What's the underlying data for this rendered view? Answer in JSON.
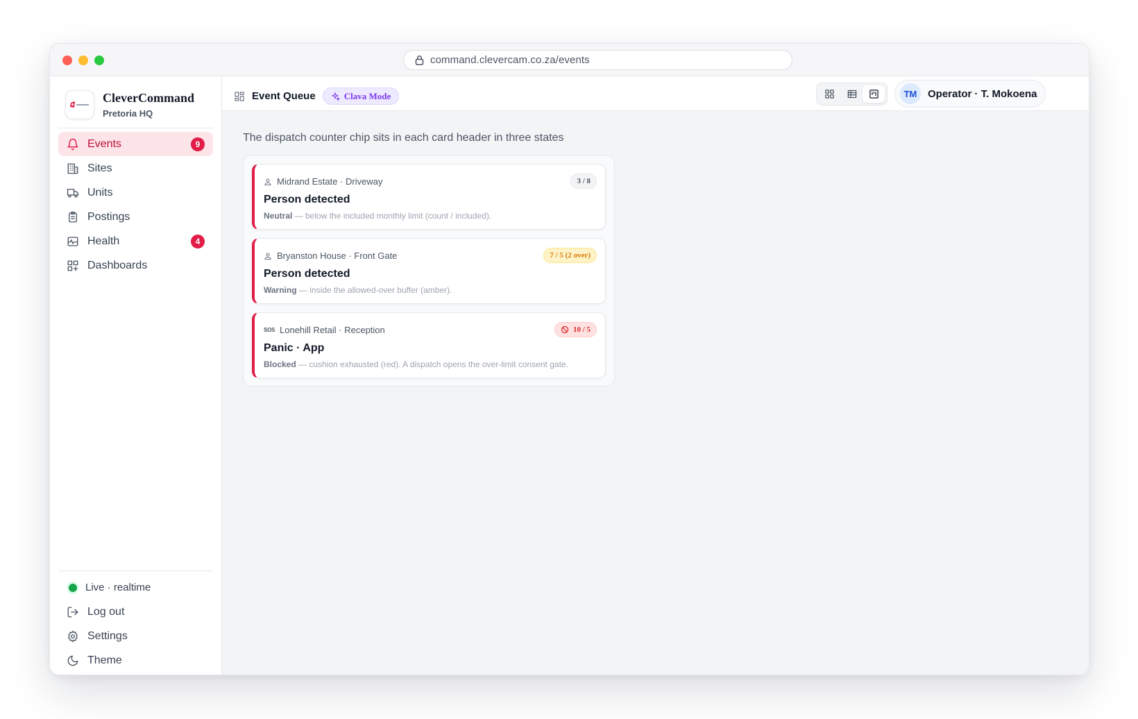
{
  "browser": {
    "url": "command.clevercam.co.za/events"
  },
  "brand": {
    "name": "CleverCommand",
    "subtitle": "Pretoria HQ"
  },
  "sidebar": {
    "items": [
      {
        "label": "Events",
        "icon": "bell-icon",
        "badge": "9",
        "active": true
      },
      {
        "label": "Sites",
        "icon": "building-icon"
      },
      {
        "label": "Units",
        "icon": "truck-icon"
      },
      {
        "label": "Postings",
        "icon": "clipboard-icon"
      },
      {
        "label": "Health",
        "icon": "activity-icon",
        "badge": "4"
      },
      {
        "label": "Dashboards",
        "icon": "grid-plus-icon"
      }
    ],
    "bottom": {
      "live": "Live · realtime",
      "logout": "Log out",
      "settings": "Settings",
      "theme": "Theme"
    }
  },
  "topbar": {
    "title": "Event Queue",
    "mode_chip": "Clava Mode",
    "operator_initials": "TM",
    "operator_name": "Operator · T. Mokoena"
  },
  "main": {
    "intro": "The dispatch counter chip sits in each card header in three states",
    "cards": [
      {
        "site": "Midrand Estate · Driveway",
        "icon": "person-icon",
        "title": "Person detected",
        "chip": "3 / 8",
        "state": "Neutral",
        "desc": " — below the included monthly limit (count / included)."
      },
      {
        "site": "Bryanston House · Front Gate",
        "icon": "person-icon",
        "title": "Person detected",
        "chip": "7 / 5 (2 over)",
        "state": "Warning",
        "desc": " — inside the allowed-over buffer (amber)."
      },
      {
        "site": "Lonehill Retail · Reception",
        "icon": "sos-icon",
        "icon_text": "SOS",
        "title": "Panic · App",
        "chip": "10 / 5",
        "state": "Blocked",
        "desc": " — cushion exhausted (red). A dispatch opens the over-limit consent gate."
      }
    ]
  },
  "colors": {
    "accent": "#e11d48",
    "active_bg": "#fde4e8",
    "warning": "#d97706",
    "blocked": "#dc2626",
    "live": "#16a34a"
  }
}
